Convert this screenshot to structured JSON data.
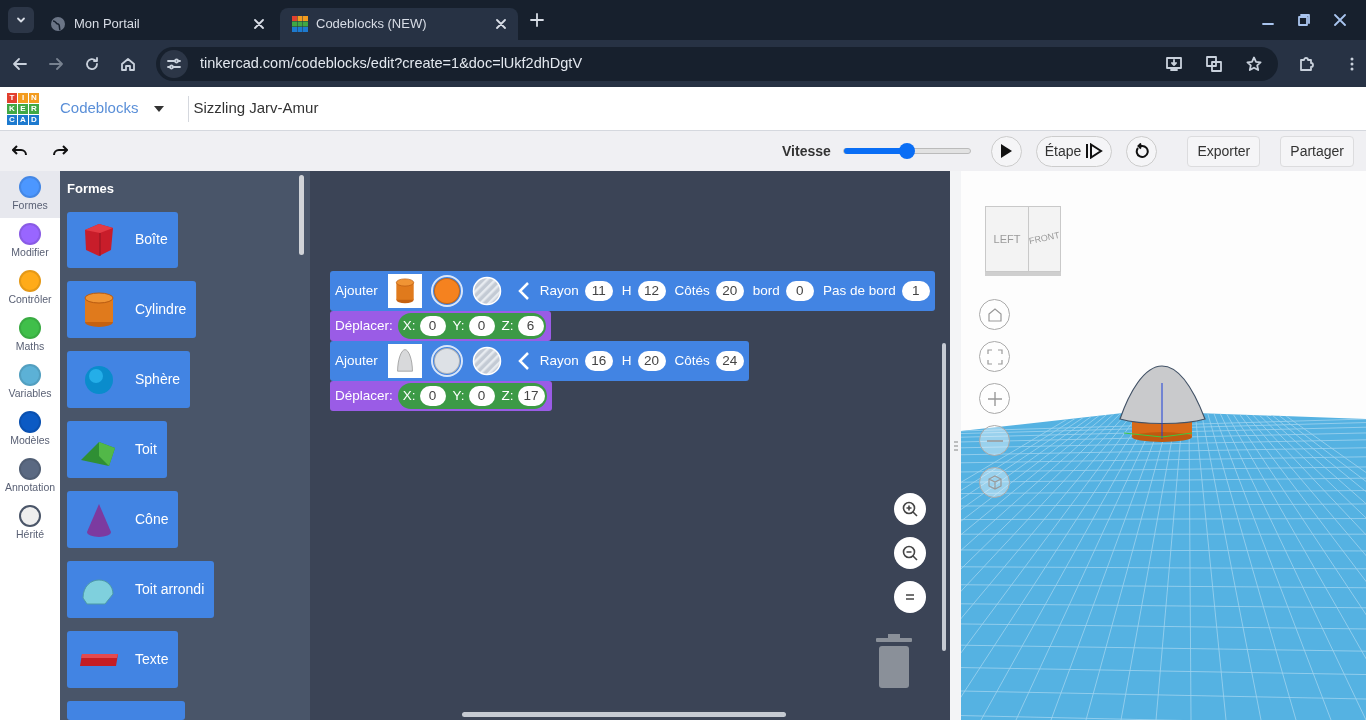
{
  "browser": {
    "tabs": [
      {
        "title": "Mon Portail",
        "selected": false,
        "kind": "globe"
      },
      {
        "title": "Codeblocks (NEW)",
        "selected": true,
        "kind": "logo"
      }
    ],
    "url": "tinkercad.com/codeblocks/edit?create=1&doc=lUkf2dhDgtV"
  },
  "header": {
    "logo_rows": [
      [
        "T",
        "I",
        "N"
      ],
      [
        "K",
        "E",
        "R"
      ],
      [
        "C",
        "A",
        "D"
      ]
    ],
    "mode_menu": "Codeblocks",
    "project_name": "Sizzling Jarv-Amur"
  },
  "toolbar": {
    "speed_label": "Vitesse",
    "speed": {
      "level": 0.5
    },
    "step_button": "Étape",
    "export_button": "Exporter",
    "share_button": "Partager"
  },
  "categories": [
    {
      "label": "Formes",
      "color": "#4c97ff",
      "selected": true
    },
    {
      "label": "Modifier",
      "color": "#9966ff",
      "selected": false
    },
    {
      "label": "Contrôler",
      "color": "#ffab19",
      "selected": false
    },
    {
      "label": "Maths",
      "color": "#40bf4a",
      "selected": false
    },
    {
      "label": "Variables",
      "color": "#5cb1d6",
      "selected": false
    },
    {
      "label": "Modèles",
      "color": "#0b5ac4",
      "selected": false
    },
    {
      "label": "Annotation",
      "color": "#5a6982",
      "selected": false
    },
    {
      "label": "Hérité",
      "color": "#eeeeee",
      "selected": false
    }
  ],
  "palette": {
    "title": "Formes",
    "blocks": [
      {
        "label": "Boîte",
        "kind": "box"
      },
      {
        "label": "Cylindre",
        "kind": "cylinder"
      },
      {
        "label": "Sphère",
        "kind": "sphere"
      },
      {
        "label": "Toit",
        "kind": "roof"
      },
      {
        "label": "Cône",
        "kind": "cone"
      },
      {
        "label": "Toit arrondi",
        "kind": "round_roof"
      },
      {
        "label": "Texte",
        "kind": "text"
      }
    ]
  },
  "program": [
    {
      "kind": "add",
      "label": "Ajouter",
      "thumbnail": {
        "kind": "cylinder"
      },
      "color": "#f5821f",
      "params": [
        {
          "label": "Rayon",
          "value": "11"
        },
        {
          "label": "H",
          "value": "12"
        },
        {
          "label": "Côtés",
          "value": "20"
        },
        {
          "label": "bord",
          "value": "0"
        },
        {
          "label": "Pas de bord",
          "value": "1"
        }
      ]
    },
    {
      "kind": "move",
      "label": "Déplacer:",
      "axes": [
        {
          "label": "X:",
          "value": "0"
        },
        {
          "label": "Y:",
          "value": "0"
        },
        {
          "label": "Z:",
          "value": "6"
        }
      ]
    },
    {
      "kind": "add",
      "label": "Ajouter",
      "thumbnail": {
        "kind": "paraboloid"
      },
      "color": "#dde1e6",
      "params": [
        {
          "label": "Rayon",
          "value": "16"
        },
        {
          "label": "H",
          "value": "20"
        },
        {
          "label": "Côtés",
          "value": "24"
        }
      ]
    },
    {
      "kind": "move",
      "label": "Déplacer:",
      "axes": [
        {
          "label": "X:",
          "value": "0"
        },
        {
          "label": "Y:",
          "value": "0"
        },
        {
          "label": "Z:",
          "value": "17"
        }
      ]
    }
  ],
  "viewer": {
    "view_cube": {
      "left": "LEFT",
      "front": "FRONT"
    }
  }
}
